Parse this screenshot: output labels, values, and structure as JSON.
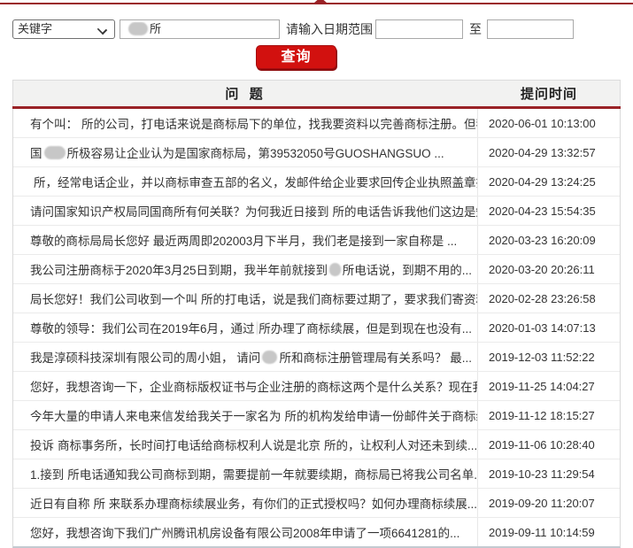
{
  "theme": {
    "accent_red": "#9a2227",
    "button_red": "#d2110f",
    "header_bg": "#f2f2f1"
  },
  "search": {
    "keyword_select": {
      "value": "关键字"
    },
    "keyword_input": {
      "segments": [
        {
          "r": 22
        },
        {
          "t": "所"
        }
      ]
    },
    "date_label": "请输入日期范围",
    "date_from_value": "",
    "to_label": "至",
    "date_to_value": "",
    "submit_label": "查询"
  },
  "table": {
    "columns": [
      {
        "label": "问 题"
      },
      {
        "label": "提问时间"
      }
    ],
    "rows": [
      {
        "q": [
          {
            "t": "有个叫："
          },
          {
            "r": 26
          },
          {
            "t": "所的公司，打电话来说是商标局下的单位，找我要资料以完善商标注册。但我..."
          }
        ],
        "time": "2020-06-01 10:13:00"
      },
      {
        "q": [
          {
            "t": "国"
          },
          {
            "r": 24
          },
          {
            "t": "所极容易让企业认为是国家商标局，第39532050号GUOSHANGSUO ..."
          }
        ],
        "time": "2020-04-29 13:32:57"
      },
      {
        "q": [
          {
            "r": 26
          },
          {
            "t": "所，经常电话企业，并以商标审查五部的名义，发邮件给企业要求回传企业执照盖章扫..."
          }
        ],
        "time": "2020-04-29 13:24:25"
      },
      {
        "q": [
          {
            "t": "请问国家知识产权局同国商所有何关联？为何我近日接到"
          },
          {
            "r": 26
          },
          {
            "t": "所的电话告诉我他们这边是知..."
          }
        ],
        "time": "2020-04-23 15:54:35"
      },
      {
        "q": [
          {
            "t": "尊敬的商标局局长您好 最近两周即202003月下半月，我们老是接到一家自称是 ..."
          }
        ],
        "time": "2020-03-23 16:20:09"
      },
      {
        "q": [
          {
            "t": "我公司注册商标于2020年3月25日到期，我半年前就接到"
          },
          {
            "r": 24
          },
          {
            "t": "所电话说，到期不用的..."
          }
        ],
        "time": "2020-03-20 20:26:11"
      },
      {
        "q": [
          {
            "t": "局长您好！我们公司收到一个叫"
          },
          {
            "r": 24
          },
          {
            "t": "所的打电话，说是我们商标要过期了，要求我们寄资料..."
          }
        ],
        "time": "2020-02-28 23:26:58"
      },
      {
        "q": [
          {
            "t": "尊敬的领导：我们公司在2019年6月，通过"
          },
          {
            "r": 24
          },
          {
            "t": "所办理了商标续展，但是到现在也没有..."
          }
        ],
        "time": "2020-01-03 14:07:13"
      },
      {
        "q": [
          {
            "t": "我是淳硕科技深圳有限公司的周小姐， 请问"
          },
          {
            "r": 26
          },
          {
            "t": "所和商标注册管理局有关系吗？ 最..."
          }
        ],
        "time": "2019-12-03 11:52:22"
      },
      {
        "q": [
          {
            "t": "您好，我想咨询一下，企业商标版权证书与企业注册的商标这两个是什么关系？现在我企业..."
          }
        ],
        "time": "2019-11-25 14:04:27"
      },
      {
        "q": [
          {
            "t": "今年大量的申请人来电来信发给我关于一家名为"
          },
          {
            "r": 28
          },
          {
            "t": "所的机构发给申请一份邮件关于商标续..."
          }
        ],
        "time": "2019-11-12 18:15:27"
      },
      {
        "q": [
          {
            "t": "投诉"
          },
          {
            "r": 22
          },
          {
            "t": "商标事务所，长时间打电话给商标权利人说是北京"
          },
          {
            "r": 24
          },
          {
            "t": "所的，让权利人对还未到续..."
          }
        ],
        "time": "2019-11-06 10:28:40"
      },
      {
        "q": [
          {
            "t": "1.接到"
          },
          {
            "r": 24
          },
          {
            "t": "所电话通知我公司商标到期，需要提前一年就要续期，商标局已将我公司名单..."
          }
        ],
        "time": "2019-10-23 11:29:54"
      },
      {
        "q": [
          {
            "t": "近日有自称"
          },
          {
            "r": 22
          },
          {
            "t": "所 来联系办理商标续展业务，有你们的正式授权吗？如何办理商标续展..."
          }
        ],
        "time": "2019-09-20 11:20:07"
      },
      {
        "q": [
          {
            "t": "您好，我想咨询下我们广州腾讯机房设备有限公司2008年申请了一项6641281的..."
          }
        ],
        "time": "2019-09-11 10:14:59"
      }
    ]
  }
}
